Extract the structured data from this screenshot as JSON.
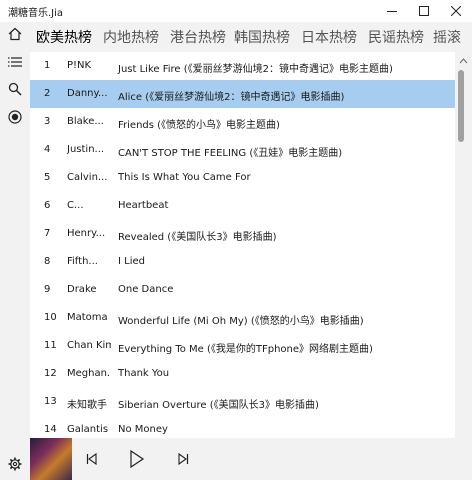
{
  "window": {
    "title": "潮糖音乐.Jia"
  },
  "tabs": [
    {
      "label": "欧美热榜"
    },
    {
      "label": "内地热榜"
    },
    {
      "label": "港台热榜"
    },
    {
      "label": "韩国热榜"
    },
    {
      "label": "日本热榜"
    },
    {
      "label": "民谣热榜"
    },
    {
      "label": "摇滚"
    }
  ],
  "active_tab": "欧美热榜",
  "songs": [
    {
      "num": "1",
      "artist": "P!NK",
      "title": "Just Like Fire (《爱丽丝梦游仙境2：镜中奇遇记》电影主题曲)"
    },
    {
      "num": "2",
      "artist": "Danny...",
      "title": "Alice (《爱丽丝梦游仙境2：镜中奇遇记》电影插曲)"
    },
    {
      "num": "3",
      "artist": "Blake...",
      "title": "Friends (《愤怒的小鸟》电影主题曲)"
    },
    {
      "num": "4",
      "artist": "Justin...",
      "title": "CAN'T STOP THE FEELING (《丑娃》电影主题曲)"
    },
    {
      "num": "5",
      "artist": "Calvin...",
      "title": "This Is What You Came For"
    },
    {
      "num": "6",
      "artist": "C...",
      "title": "Heartbeat"
    },
    {
      "num": "7",
      "artist": "Henry...",
      "title": "Revealed (《美国队长3》电影插曲)"
    },
    {
      "num": "8",
      "artist": "Fifth...",
      "title": "I Lied"
    },
    {
      "num": "9",
      "artist": "Drake",
      "title": "One Dance"
    },
    {
      "num": "10",
      "artist": "Matoma",
      "title": "Wonderful Life (Mi Oh My) (《愤怒的小鸟》电影插曲)"
    },
    {
      "num": "11",
      "artist": "Chan Kim",
      "title": "Everything To Me (《我是你的TFphone》网络剧主题曲)"
    },
    {
      "num": "12",
      "artist": "Meghan...",
      "title": "Thank You"
    },
    {
      "num": "13",
      "artist": "未知歌手",
      "title": "Siberian Overture (《美国队长3》电影插曲)"
    },
    {
      "num": "14",
      "artist": "Galantis",
      "title": "No Money"
    }
  ],
  "selected_song": "2",
  "colors": {
    "selected_row": "#a6cdf0",
    "panel": "#f2f2f2"
  },
  "icons": {
    "sidebar": [
      "home-icon",
      "playlist-icon",
      "search-icon",
      "now-playing-icon"
    ],
    "settings": "gear-icon",
    "player": [
      "previous-icon",
      "play-icon",
      "next-icon"
    ],
    "window": [
      "minimize-icon",
      "maximize-icon",
      "close-icon"
    ]
  }
}
